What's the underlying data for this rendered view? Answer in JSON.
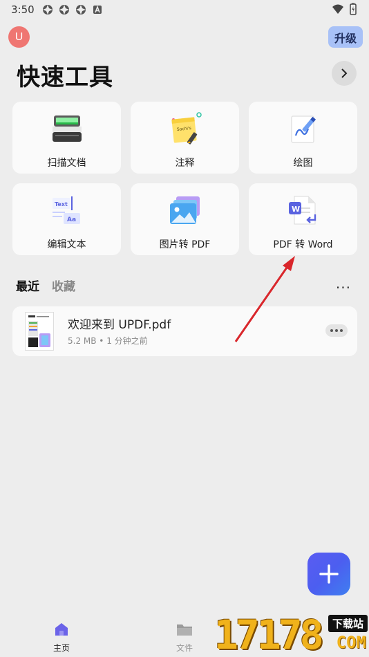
{
  "status_bar": {
    "time": "3:50"
  },
  "header": {
    "avatar_letter": "U",
    "upgrade_label": "升级",
    "title": "快速工具"
  },
  "tools": [
    {
      "label": "扫描文档",
      "icon": "scanner-icon"
    },
    {
      "label": "注释",
      "icon": "sticky-note-icon"
    },
    {
      "label": "绘图",
      "icon": "draw-pen-icon"
    },
    {
      "label": "编辑文本",
      "icon": "edit-text-icon"
    },
    {
      "label": "图片转 PDF",
      "icon": "image-to-pdf-icon"
    },
    {
      "label": "PDF 转 Word",
      "icon": "pdf-to-word-icon"
    }
  ],
  "tool_icon_text": {
    "note": "Sochi's",
    "text": "Text",
    "aa": "Aa",
    "word": "W"
  },
  "recent": {
    "tabs": [
      "最近",
      "收藏"
    ],
    "more": "...",
    "files": [
      {
        "name": "欢迎来到 UPDF.pdf",
        "meta": "5.2 MB • 1 分钟之前"
      }
    ]
  },
  "bottom_nav": {
    "home_label": "主页",
    "files_label": "文件"
  },
  "watermark": {
    "digits": "17178",
    "tag": "下载站",
    "suffix": "COM"
  },
  "colors": {
    "background": "#ededed",
    "card": "#fafafa",
    "avatar": "#ef7672",
    "upgrade": "#a8c1f7",
    "accent": "#5a5cf2",
    "annotation_arrow": "#d9262b"
  }
}
